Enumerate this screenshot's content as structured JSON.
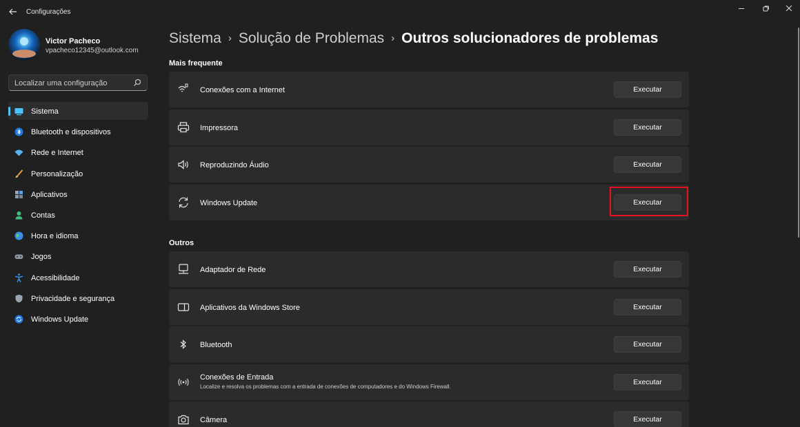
{
  "window": {
    "title": "Configurações",
    "controls": {
      "minimize": "minimize-icon",
      "maximize": "restore-icon",
      "close": "close-icon"
    }
  },
  "user": {
    "name": "Victor Pacheco",
    "email": "vpacheco12345@outlook.com"
  },
  "search": {
    "placeholder": "Localizar uma configuração"
  },
  "sidebar": {
    "items": [
      {
        "label": "Sistema",
        "icon": "system-icon",
        "active": true
      },
      {
        "label": "Bluetooth e dispositivos",
        "icon": "bluetooth-icon"
      },
      {
        "label": "Rede e Internet",
        "icon": "wifi-icon"
      },
      {
        "label": "Personalização",
        "icon": "brush-icon"
      },
      {
        "label": "Aplicativos",
        "icon": "apps-icon"
      },
      {
        "label": "Contas",
        "icon": "account-icon"
      },
      {
        "label": "Hora e idioma",
        "icon": "globe-icon"
      },
      {
        "label": "Jogos",
        "icon": "gamepad-icon"
      },
      {
        "label": "Acessibilidade",
        "icon": "accessibility-icon"
      },
      {
        "label": "Privacidade e segurança",
        "icon": "shield-icon"
      },
      {
        "label": "Windows Update",
        "icon": "windows-update-icon"
      }
    ]
  },
  "breadcrumb": {
    "items": [
      "Sistema",
      "Solução de Problemas"
    ],
    "current": "Outros solucionadores de problemas"
  },
  "sections": {
    "frequent": {
      "title": "Mais frequente",
      "items": [
        {
          "title": "Conexões com a Internet",
          "icon": "internet-icon",
          "button": "Executar"
        },
        {
          "title": "Impressora",
          "icon": "printer-icon",
          "button": "Executar"
        },
        {
          "title": "Reproduzindo Áudio",
          "icon": "speaker-icon",
          "button": "Executar"
        },
        {
          "title": "Windows Update",
          "icon": "refresh-icon",
          "button": "Executar",
          "highlighted": true
        }
      ]
    },
    "others": {
      "title": "Outros",
      "items": [
        {
          "title": "Adaptador de Rede",
          "icon": "network-adapter-icon",
          "button": "Executar"
        },
        {
          "title": "Aplicativos da Windows Store",
          "icon": "store-apps-icon",
          "button": "Executar"
        },
        {
          "title": "Bluetooth",
          "icon": "bluetooth-icon",
          "button": "Executar"
        },
        {
          "title": "Conexões de Entrada",
          "description": "Localize e resolva os problemas com a entrada de conexões de computadores e do Windows Firewall.",
          "icon": "incoming-connection-icon",
          "button": "Executar"
        },
        {
          "title": "Câmera",
          "icon": "camera-icon",
          "button": "Executar"
        }
      ]
    }
  },
  "colors": {
    "background": "#202020",
    "card": "#2b2b2b",
    "accent": "#4cc2ff",
    "highlight": "#e81123"
  }
}
